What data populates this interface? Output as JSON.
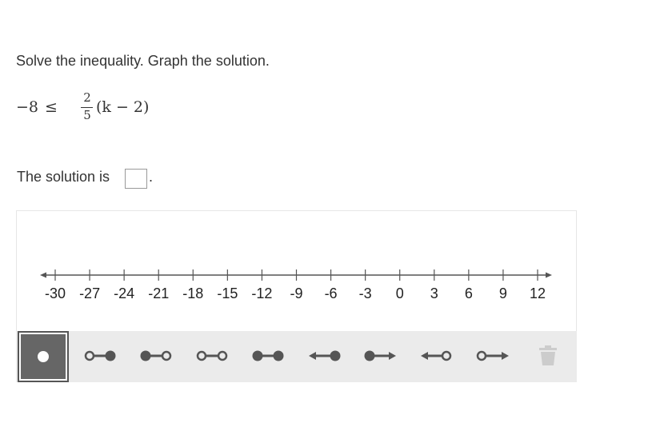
{
  "question": {
    "prompt": "Solve the inequality. Graph the solution.",
    "inequality": {
      "lhs": "−8",
      "relation": "≤",
      "fraction_numerator": "2",
      "fraction_denominator": "5",
      "rhs_expression": "(k − 2)"
    },
    "solution_label": "The solution is",
    "solution_value": "",
    "solution_suffix": "."
  },
  "number_line": {
    "min": -30,
    "max": 12,
    "step": 3,
    "ticks": [
      "-30",
      "-27",
      "-24",
      "-21",
      "-18",
      "-15",
      "-12",
      "-9",
      "-6",
      "-3",
      "0",
      "3",
      "6",
      "9",
      "12"
    ],
    "line_color": "#555555"
  },
  "toolbar": {
    "tools": [
      {
        "name": "point-tool",
        "icon": "closed-point-icon",
        "selected": true
      },
      {
        "name": "open-closed-segment-tool",
        "icon": "open-closed-segment-icon",
        "selected": false
      },
      {
        "name": "closed-open-segment-tool",
        "icon": "closed-open-segment-icon",
        "selected": false
      },
      {
        "name": "open-open-segment-tool",
        "icon": "open-open-segment-icon",
        "selected": false
      },
      {
        "name": "closed-closed-segment-tool",
        "icon": "closed-closed-segment-icon",
        "selected": false
      },
      {
        "name": "left-ray-closed-tool",
        "icon": "left-ray-closed-icon",
        "selected": false
      },
      {
        "name": "right-ray-closed-tool",
        "icon": "right-ray-closed-icon",
        "selected": false
      },
      {
        "name": "left-ray-open-tool",
        "icon": "left-ray-open-icon",
        "selected": false
      },
      {
        "name": "right-ray-open-tool",
        "icon": "right-ray-open-icon",
        "selected": false
      },
      {
        "name": "delete-tool",
        "icon": "trash-icon",
        "selected": false,
        "disabled": true
      }
    ],
    "icon_color": "#555555",
    "selected_bg": "#666666",
    "disabled_color": "#cccccc"
  }
}
